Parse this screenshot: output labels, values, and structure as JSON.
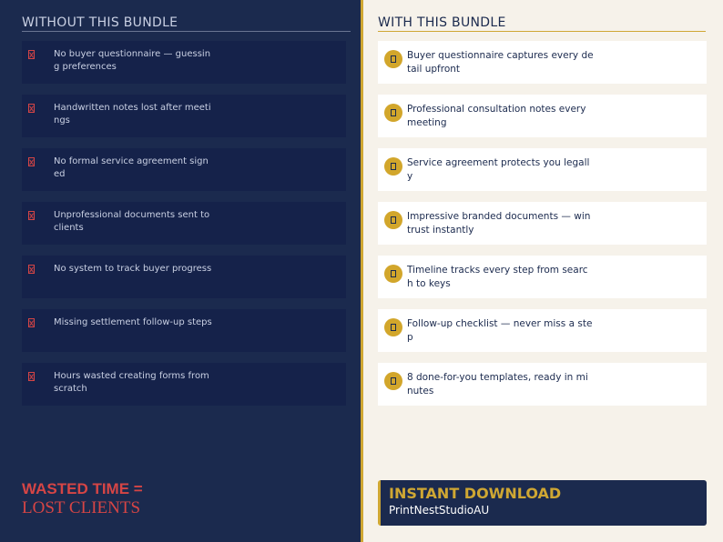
{
  "left": {
    "heading": "WITHOUT THIS BUNDLE",
    "items": [
      {
        "text": "No buyer questionnaire — guessing preferences",
        "icon": "cross-icon"
      },
      {
        "text": "Handwritten notes lost after meetings",
        "icon": "cross-icon"
      },
      {
        "text": "No formal service agreement signed",
        "icon": "cross-icon"
      },
      {
        "text": "Unprofessional documents sent to clients",
        "icon": "cross-icon"
      },
      {
        "text": "No system to track buyer progress",
        "icon": "cross-icon"
      },
      {
        "text": "Missing settlement follow-up steps",
        "icon": "cross-icon"
      },
      {
        "text": "Hours wasted creating forms from scratch",
        "icon": "cross-icon"
      }
    ],
    "footer_line1": "WASTED TIME =",
    "footer_line2": "LOST CLIENTS"
  },
  "right": {
    "heading": "WITH THIS BUNDLE",
    "items": [
      {
        "text": "Buyer questionnaire captures every detail upfront",
        "icon": "check-icon"
      },
      {
        "text": "Professional consultation notes every meeting",
        "icon": "check-icon"
      },
      {
        "text": "Service agreement protects you legally",
        "icon": "check-icon"
      },
      {
        "text": "Impressive branded documents — win trust  instantly",
        "icon": "check-icon"
      },
      {
        "text": "Timeline tracks every step from search to keys",
        "icon": "check-icon"
      },
      {
        "text": "Follow-up checklist — never miss a step",
        "icon": "check-icon"
      },
      {
        "text": "8 done-for-you templates, ready in minutes",
        "icon": "check-icon"
      }
    ],
    "download_title": "INSTANT DOWNLOAD",
    "download_subtitle": "PrintNestStudioAU"
  },
  "colors": {
    "navy": "#1b2a4e",
    "gold": "#cfa733",
    "red": "#d64545",
    "cream": "#f6f2ea"
  }
}
